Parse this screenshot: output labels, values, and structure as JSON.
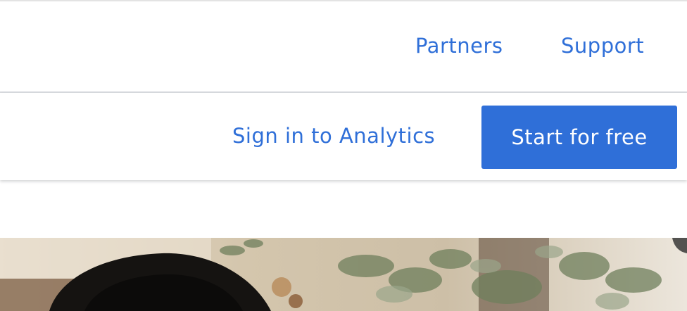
{
  "header": {
    "links": {
      "partners": "Partners",
      "support": "Support"
    }
  },
  "actions": {
    "sign_in": "Sign in to Analytics",
    "start": "Start for free"
  },
  "colors": {
    "link": "#2f6fd8",
    "button_bg": "#2f6fd8",
    "button_text": "#ffffff"
  },
  "hero": {
    "image": "photo-woman-with-plants"
  }
}
